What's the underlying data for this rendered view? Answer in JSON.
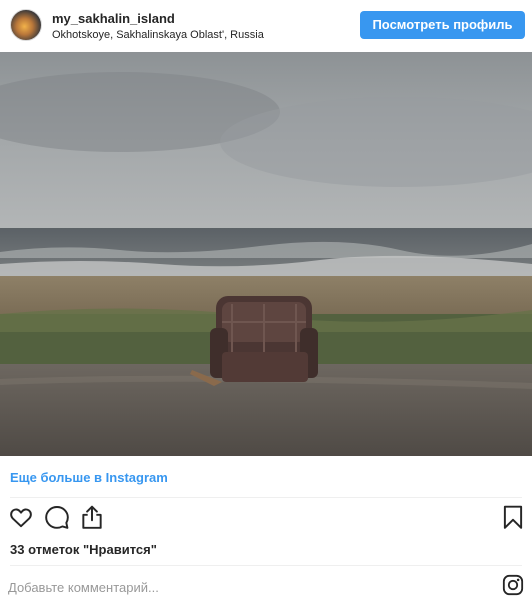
{
  "post": {
    "username": "my_sakhalin_island",
    "location": "Okhotskoye, Sakhalinskaya Oblast', Russia",
    "view_profile_label": "Посмотреть профиль",
    "more_link_label": "Еще больше в Instagram",
    "likes_text": "33 отметок \"Нравится\"",
    "comment_placeholder": "Добавьте комментарий..."
  },
  "icons": {
    "like": "heart-icon",
    "comment": "comment-icon",
    "share": "share-icon",
    "save": "bookmark-icon",
    "brand": "instagram-icon"
  },
  "colors": {
    "accent": "#3897f0",
    "text": "#262626",
    "muted": "#999999"
  }
}
